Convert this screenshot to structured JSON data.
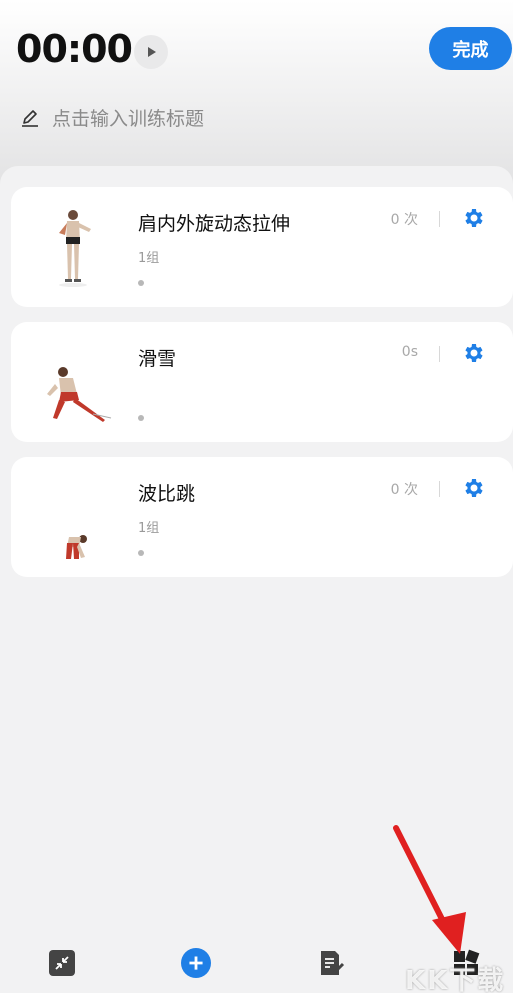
{
  "header": {
    "timer": "00:00",
    "done_label": "完成",
    "title_placeholder": "点击输入训练标题"
  },
  "exercises": [
    {
      "name": "肩内外旋动态拉伸",
      "sets": "1组",
      "count": "0 次"
    },
    {
      "name": "滑雪",
      "sets": "",
      "count": "0s"
    },
    {
      "name": "波比跳",
      "sets": "1组",
      "count": "0 次"
    }
  ],
  "bottom_nav": [
    {
      "icon": "collapse-icon"
    },
    {
      "icon": "add-icon"
    },
    {
      "icon": "edit-note-icon"
    },
    {
      "icon": "grid-icon"
    }
  ],
  "colors": {
    "accent": "#1f7fe6",
    "arrow": "#e02020"
  },
  "watermark": "KK下载"
}
